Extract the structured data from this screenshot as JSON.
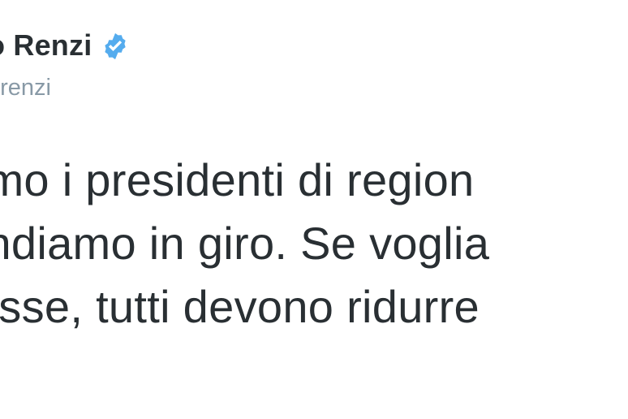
{
  "tweet": {
    "display_name": "o Renzi",
    "handle": "orenzi",
    "verified_icon": "verified-badge-icon",
    "text": "emo i presidenti di region\nendiamo in giro. Se voglia\n tasse, tutti devono ridurre\ne"
  },
  "colors": {
    "text": "#292f33",
    "handle": "#8899a6",
    "verified": "#55acee"
  }
}
